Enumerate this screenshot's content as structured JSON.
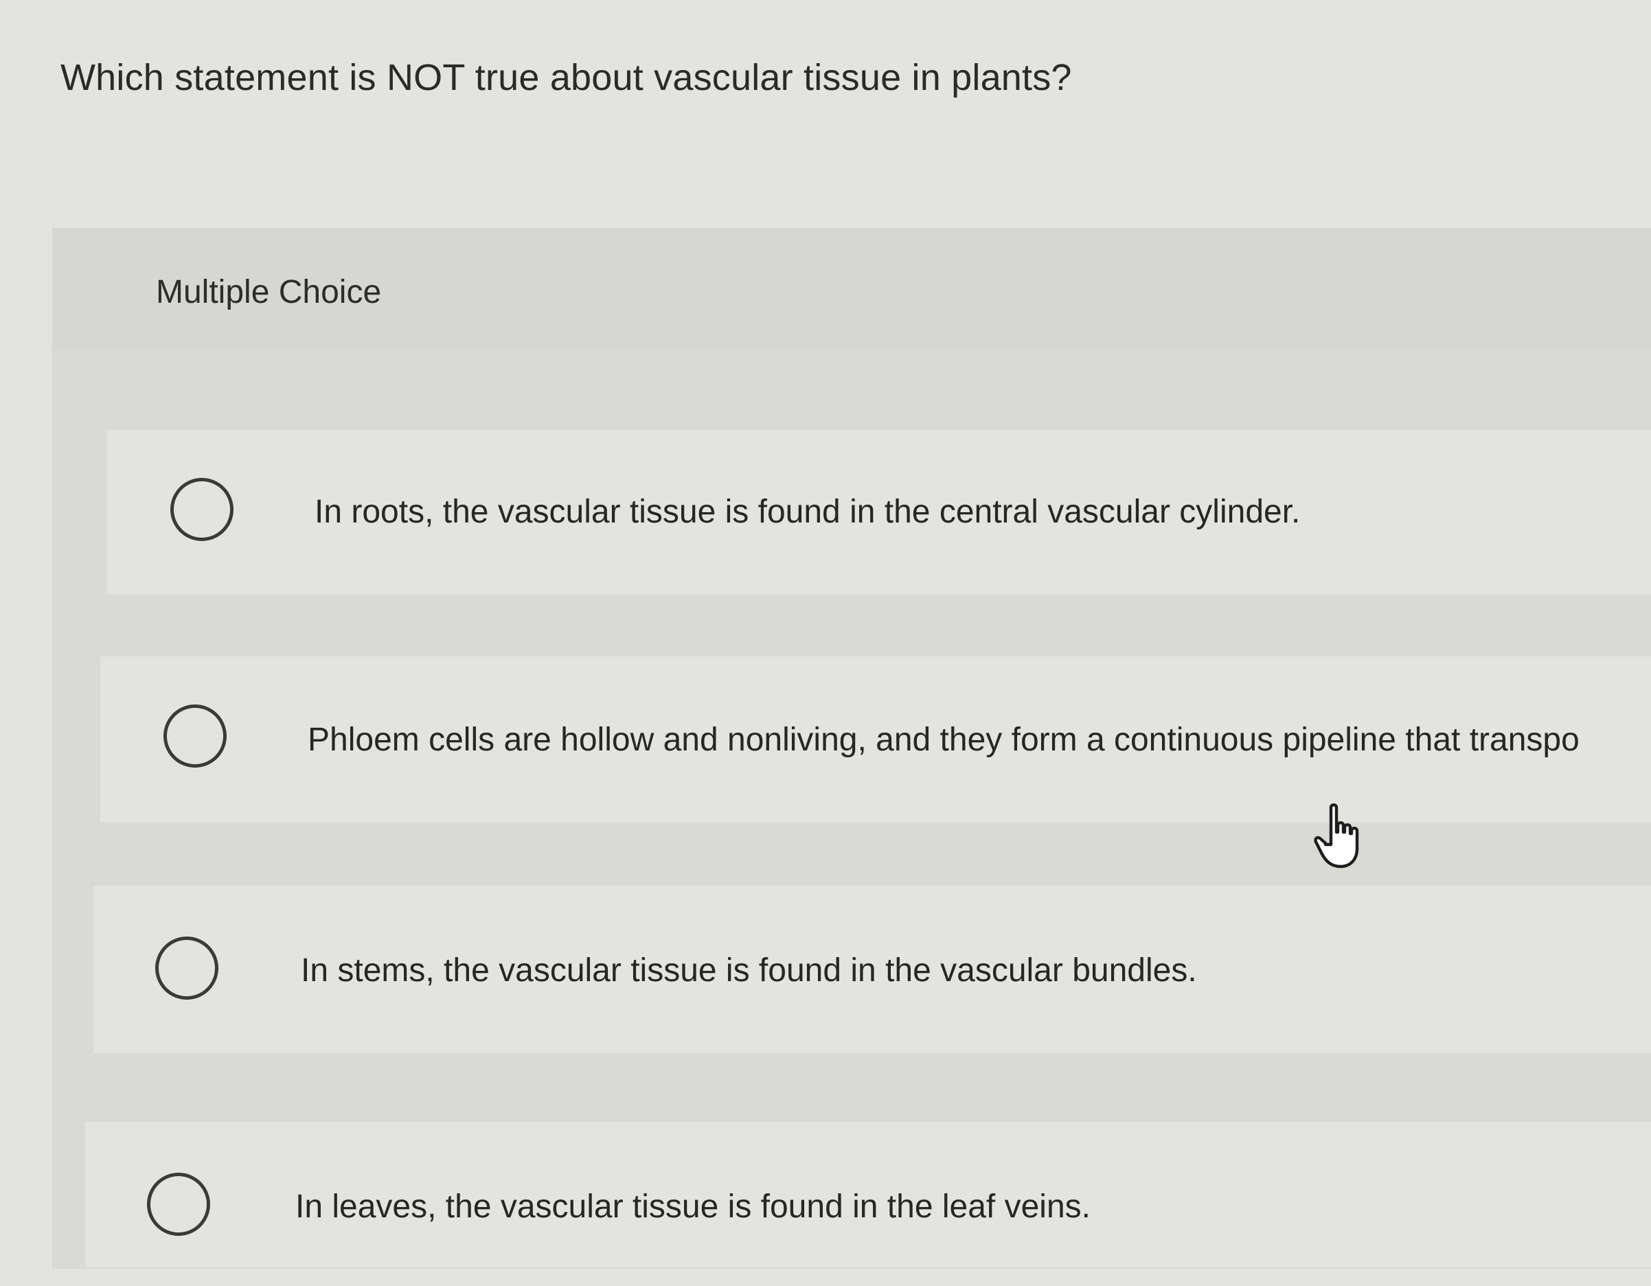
{
  "question": {
    "text": "Which statement is NOT true about vascular tissue in plants?"
  },
  "section": {
    "label": "Multiple Choice"
  },
  "options": [
    {
      "label": "In roots, the vascular tissue is found in the central vascular cylinder."
    },
    {
      "label": "Phloem cells are hollow and nonliving, and they form a continuous pipeline that transpo"
    },
    {
      "label": "In stems, the vascular tissue is found in the vascular bundles."
    },
    {
      "label": "In leaves, the vascular tissue is found in the leaf veins."
    }
  ],
  "icons": {
    "radio": "radio-button-icon",
    "cursor": "hand-pointer-cursor-icon"
  },
  "colors": {
    "background": "#e3e3df",
    "panel": "#d9d9d5",
    "text": "#2a2a2a"
  }
}
